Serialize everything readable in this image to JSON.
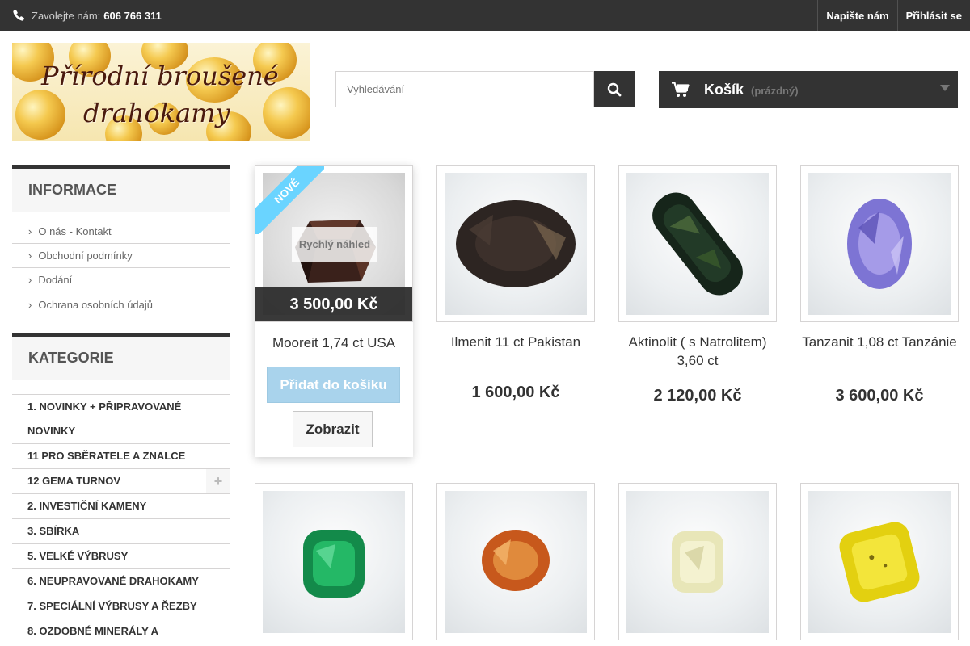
{
  "topbar": {
    "contact_label": "Zavolejte nám:",
    "phone": "606 766 311",
    "links": [
      "Napište nám",
      "Přihlásit se"
    ]
  },
  "logo": {
    "line1": "Přírodní broušené",
    "line2": "drahokamy"
  },
  "search": {
    "placeholder": "Vyhledávání"
  },
  "cart": {
    "title": "Košík",
    "status": "(prázdný)"
  },
  "sidebar": {
    "info_title": "INFORMACE",
    "info_items": [
      "O nás - Kontakt",
      "Obchodní podmínky",
      "Dodání",
      "Ochrana osobních údajů"
    ],
    "categories_title": "KATEGORIE",
    "categories": [
      "1. NOVINKY + PŘIPRAVOVANÉ NOVINKY",
      "11 PRO SBĚRATELE A ZNALCE",
      "12 GEMA TURNOV",
      "2. INVESTIČNÍ KAMENY",
      "3. SBÍRKA",
      "5. VELKÉ VÝBRUSY",
      "6. NEUPRAVOVANÉ DRAHOKAMY",
      "7. SPECIÁLNÍ VÝBRUSY A ŘEZBY",
      "8. OZDOBNÉ MINERÁLY A"
    ]
  },
  "products": [
    {
      "name": "Mooreit 1,74 ct USA",
      "price": "3 500,00 Kč",
      "badge": "Nové",
      "quick_view": "Rychlý náhled",
      "add_to_cart": "Přidat do košíku",
      "view": "Zobrazit"
    },
    {
      "name": "Ilmenit 11 ct Pakistan",
      "price": "1 600,00 Kč"
    },
    {
      "name": "Aktinolit ( s Natrolitem) 3,60 ct",
      "price": "2 120,00 Kč"
    },
    {
      "name": "Tanzanit 1,08 ct Tanzánie",
      "price": "3 600,00 Kč"
    }
  ],
  "colors": {
    "dark": "#333333",
    "ribbon": "#6ad4ff",
    "add_button": "#a9d3ec"
  }
}
